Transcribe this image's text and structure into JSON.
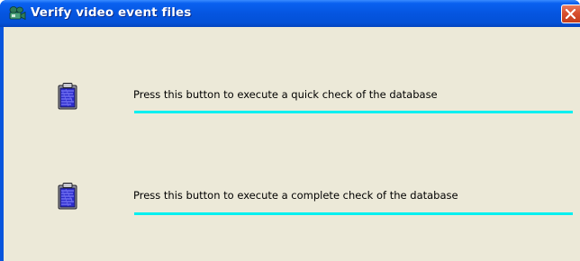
{
  "window": {
    "title": "Verify video event files",
    "title_icon": "video-camera-icon",
    "close_icon": "close-icon"
  },
  "actions": [
    {
      "icon": "clipboard-icon",
      "label": "Press this button to execute a quick check of the database",
      "progress": 1.0
    },
    {
      "icon": "clipboard-icon",
      "label": "Press this button to execute a complete check of the database",
      "progress": 1.0
    }
  ],
  "colors": {
    "titlebar": "#0555e0",
    "client_background": "#ece9d8",
    "progress_fill": "#00f0f0",
    "close_button": "#d8502f"
  }
}
